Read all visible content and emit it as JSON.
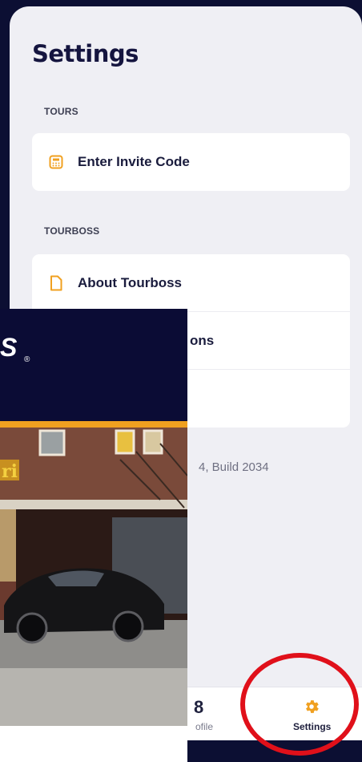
{
  "page": {
    "title": "Settings"
  },
  "sections": [
    {
      "label": "TOURS",
      "items": [
        {
          "label": "Enter Invite Code",
          "icon": "calculator-icon"
        }
      ]
    },
    {
      "label": "TOURBOSS",
      "items": [
        {
          "label": "About Tourboss",
          "icon": "document-icon"
        },
        {
          "label": "ons",
          "icon": ""
        },
        {
          "label": "",
          "icon": ""
        }
      ]
    }
  ],
  "version_text": "4, Build 2034",
  "tabbar": {
    "profile": {
      "label": "ofile",
      "glyph": "8"
    },
    "settings": {
      "label": "Settings",
      "icon": "gear-icon"
    }
  },
  "overlay": {
    "logo_text": "S",
    "registered_mark": "®",
    "sign_text": "ri",
    "photo_description_icon": "car-photo"
  },
  "colors": {
    "background": "#0c0f33",
    "panel": "#efeff4",
    "icon_accent": "#f0a020",
    "highlight_circle": "#e0101a"
  }
}
